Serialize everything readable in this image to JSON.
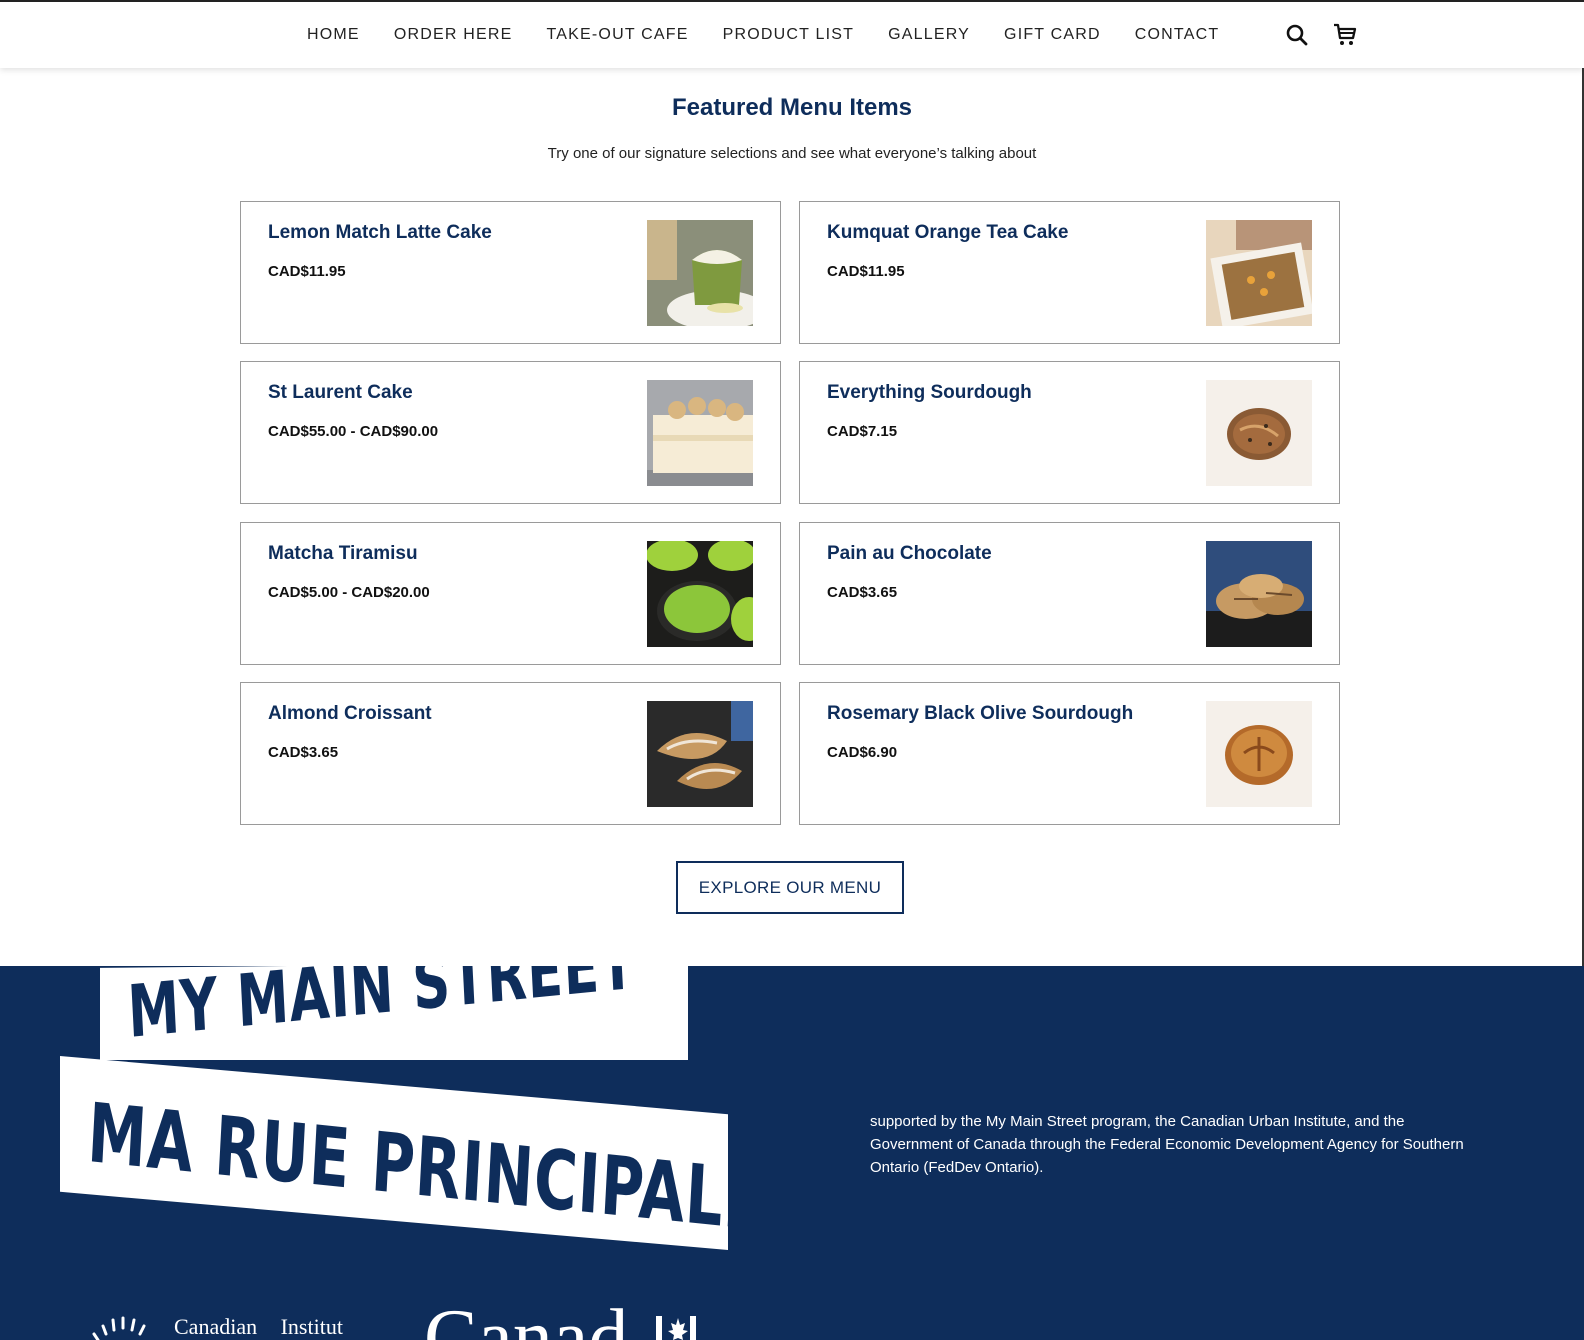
{
  "nav": {
    "items": [
      {
        "label": "HOME"
      },
      {
        "label": "ORDER HERE"
      },
      {
        "label": "TAKE-OUT CAFE"
      },
      {
        "label": "PRODUCT LIST"
      },
      {
        "label": "GALLERY"
      },
      {
        "label": "GIFT CARD"
      },
      {
        "label": "CONTACT"
      }
    ],
    "icons": [
      "search-icon",
      "cart-icon"
    ]
  },
  "featured": {
    "title": "Featured Menu Items",
    "subtitle": "Try one of our signature selections and see what everyone’s talking about",
    "items": [
      {
        "name": "Lemon Match Latte Cake",
        "price": "CAD$11.95",
        "thumb": "matcha-cake"
      },
      {
        "name": "Kumquat Orange Tea Cake",
        "price": "CAD$11.95",
        "thumb": "loaf-cake"
      },
      {
        "name": "St Laurent Cake",
        "price": "CAD$55.00 - CAD$90.00",
        "thumb": "cream-cake"
      },
      {
        "name": "Everything Sourdough",
        "price": "CAD$7.15",
        "thumb": "sourdough-seeded"
      },
      {
        "name": "Matcha Tiramisu",
        "price": "CAD$5.00 - CAD$20.00",
        "thumb": "matcha-tiramisu"
      },
      {
        "name": "Pain au Chocolate",
        "price": "CAD$3.65",
        "thumb": "pastries"
      },
      {
        "name": "Almond Croissant",
        "price": "CAD$3.65",
        "thumb": "croissants"
      },
      {
        "name": "Rosemary Black Olive Sourdough",
        "price": "CAD$6.90",
        "thumb": "sourdough-round"
      }
    ],
    "cta": "EXPLORE OUR MENU"
  },
  "footer": {
    "banner_line1": "MY MAIN STREET",
    "banner_line2": "MA RUE PRINCIPALE",
    "support_text": "supported by the My Main Street program, the Canadian Urban Institute, and the Government of Canada through the Federal Economic Development Agency for Southern Ontario (FedDev Ontario).",
    "cui_word1": "Canadian",
    "cui_word2": "Institut",
    "canada_wordmark": "Canad"
  },
  "colors": {
    "brand_navy": "#0e2d5b",
    "card_border": "#9a9a9a"
  }
}
